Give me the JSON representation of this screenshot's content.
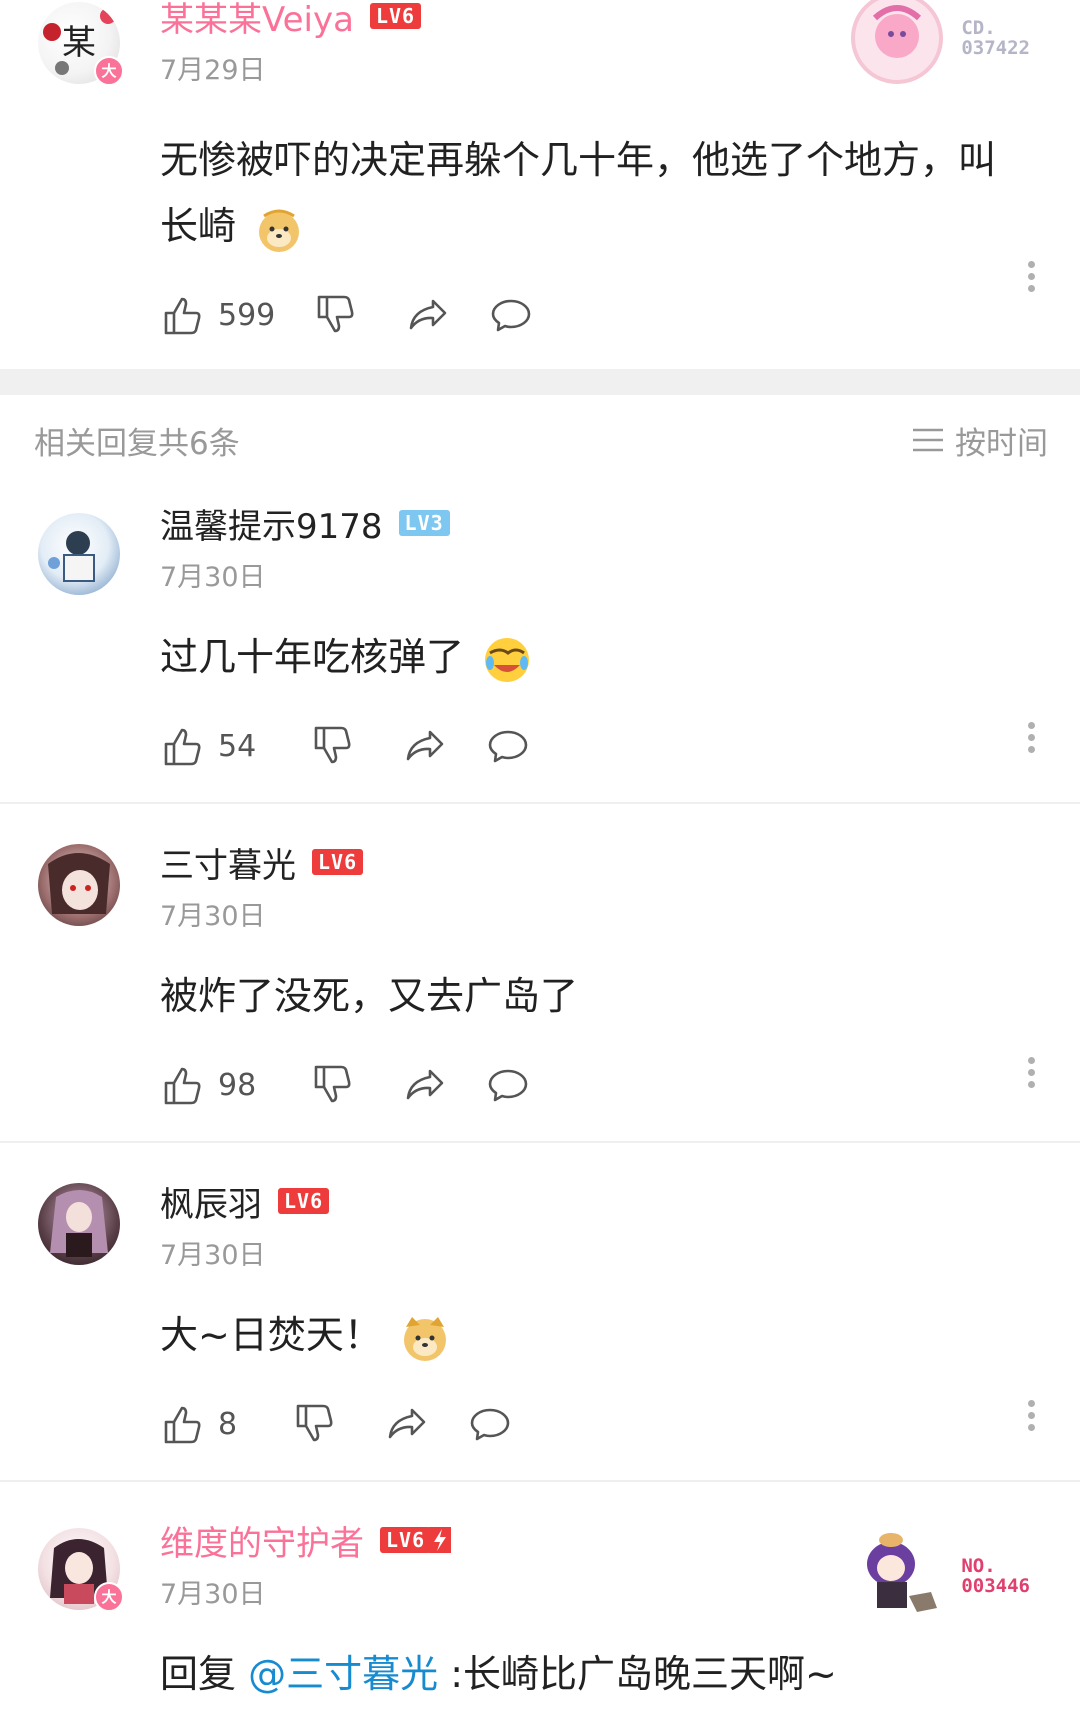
{
  "main_comment": {
    "username": "某某某Veiya",
    "level": "LV6",
    "date": "7月29日",
    "content": "无惨被吓的决定再躲个几十年，他选了个地方，叫长崎",
    "likes": "599",
    "fan_medal_no": [
      "CD.",
      "037422"
    ]
  },
  "replies_header": {
    "count_label": "相关回复共6条",
    "sort_label": "按时间"
  },
  "replies": [
    {
      "username": "温馨提示9178",
      "level": "LV3",
      "date": "7月30日",
      "content": "过几十年吃核弹了",
      "likes": "54"
    },
    {
      "username": "三寸暮光",
      "level": "LV6",
      "date": "7月30日",
      "content": "被炸了没死，又去广岛了",
      "likes": "98"
    },
    {
      "username": "枫辰羽",
      "level": "LV6",
      "date": "7月30日",
      "content": "大~日焚天！",
      "likes": "8"
    },
    {
      "username": "维度的守护者",
      "level": "LV6",
      "date": "7月30日",
      "content_prefix": "回复 ",
      "mention": "@三寸暮光",
      "content_suffix": " :长崎比广岛晚三天啊~",
      "fan_medal_no": [
        "NO.",
        "003446"
      ]
    }
  ],
  "vip_badge_text": "大",
  "colors": {
    "vip_pink": "#fb7299",
    "lv6_red": "#ee3b3b",
    "lv3_blue": "#7ec7f0",
    "mention_blue": "#178bcf"
  }
}
